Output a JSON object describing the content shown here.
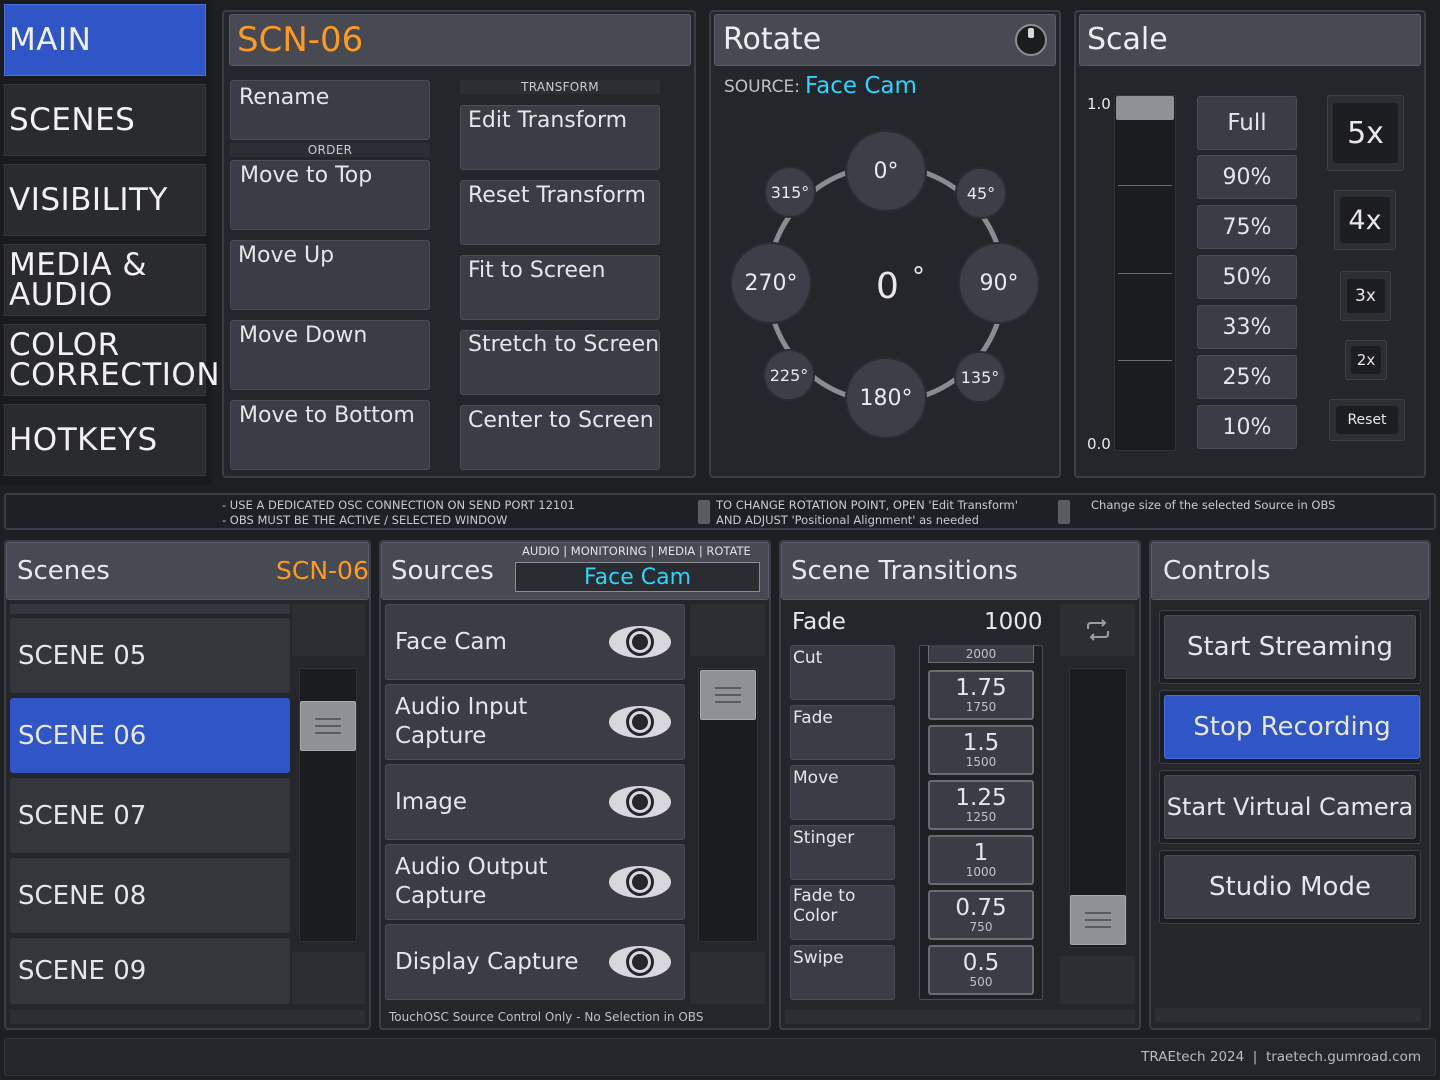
{
  "nav": {
    "main": "MAIN",
    "scenes": "SCENES",
    "visibility": "VISIBILITY",
    "media_audio": [
      "MEDIA &",
      "AUDIO"
    ],
    "color_correction": [
      "COLOR",
      "CORRECTION"
    ],
    "hotkeys": "HOTKEYS"
  },
  "scene_panel": {
    "title": "SCN-06",
    "rename": "Rename",
    "order_label": "ORDER",
    "transform_label": "TRANSFORM",
    "order_buttons": [
      "Move to Top",
      "Move Up",
      "Move Down",
      "Move to Bottom"
    ],
    "transform_buttons": [
      "Edit Transform",
      "Reset Transform",
      "Fit to Screen",
      "Stretch to Screen",
      "Center to Screen"
    ]
  },
  "rotate": {
    "title": "Rotate",
    "source_label": "SOURCE:",
    "source_value": "Face Cam",
    "current": "0",
    "degree_symbol": "°",
    "angles": {
      "a0": "0°",
      "a45": "45°",
      "a90": "90°",
      "a135": "135°",
      "a180": "180°",
      "a225": "225°",
      "a270": "270°",
      "a315": "315°"
    }
  },
  "scale": {
    "title": "Scale",
    "max_label": "1.0",
    "min_label": "0.0",
    "slider_value": 1.0,
    "percent_buttons": [
      "Full",
      "90%",
      "75%",
      "50%",
      "33%",
      "25%",
      "10%"
    ],
    "multipliers": [
      "5x",
      "4x",
      "3x",
      "2x"
    ],
    "reset": "Reset"
  },
  "notes": {
    "osc_line1": "- USE A DEDICATED OSC CONNECTION ON SEND PORT 12101",
    "osc_line2": "- OBS MUST BE THE ACTIVE / SELECTED WINDOW",
    "rotate_line1": "TO CHANGE ROTATION POINT, OPEN 'Edit Transform'",
    "rotate_line2": "AND ADJUST 'Positional Alignment' as needed",
    "scale_line": "Change size of the selected Source in OBS"
  },
  "scenes": {
    "title": "Scenes",
    "current": "SCN-06",
    "items": [
      "SCENE 05",
      "SCENE 06",
      "SCENE 07",
      "SCENE 08",
      "SCENE 09"
    ],
    "selected_index": 1
  },
  "sources": {
    "title": "Sources",
    "filter_label": "AUDIO | MONITORING | MEDIA | ROTATE",
    "selected": "Face Cam",
    "items": [
      [
        "Face Cam"
      ],
      [
        "Audio Input",
        "Capture"
      ],
      [
        "Image"
      ],
      [
        "Audio Output",
        "Capture"
      ],
      [
        "Display Capture"
      ]
    ],
    "footer": "TouchOSC Source Control Only - No Selection in OBS"
  },
  "transitions": {
    "title": "Scene Transitions",
    "current_name": "Fade",
    "current_duration": "1000",
    "types": [
      [
        "Cut"
      ],
      [
        "Fade"
      ],
      [
        "Move"
      ],
      [
        "Stinger"
      ],
      [
        "Fade to",
        "Color"
      ],
      [
        "Swipe"
      ]
    ],
    "durations_top": "2000",
    "durations": [
      {
        "label": "1.75",
        "ms": "1750"
      },
      {
        "label": "1.5",
        "ms": "1500"
      },
      {
        "label": "1.25",
        "ms": "1250"
      },
      {
        "label": "1",
        "ms": "1000"
      },
      {
        "label": "0.75",
        "ms": "750"
      },
      {
        "label": "0.5",
        "ms": "500"
      }
    ]
  },
  "controls": {
    "title": "Controls",
    "buttons": [
      "Start Streaming",
      "Stop Recording",
      "Start Virtual Camera",
      "Studio Mode"
    ],
    "active_index": 1
  },
  "footer": {
    "credit": "TRAEtech 2024  |  traetech.gumroad.com"
  },
  "colors": {
    "accent_orange": "#ff9a1f",
    "accent_cyan": "#27d7ff",
    "active_blue": "#2f55c6"
  }
}
